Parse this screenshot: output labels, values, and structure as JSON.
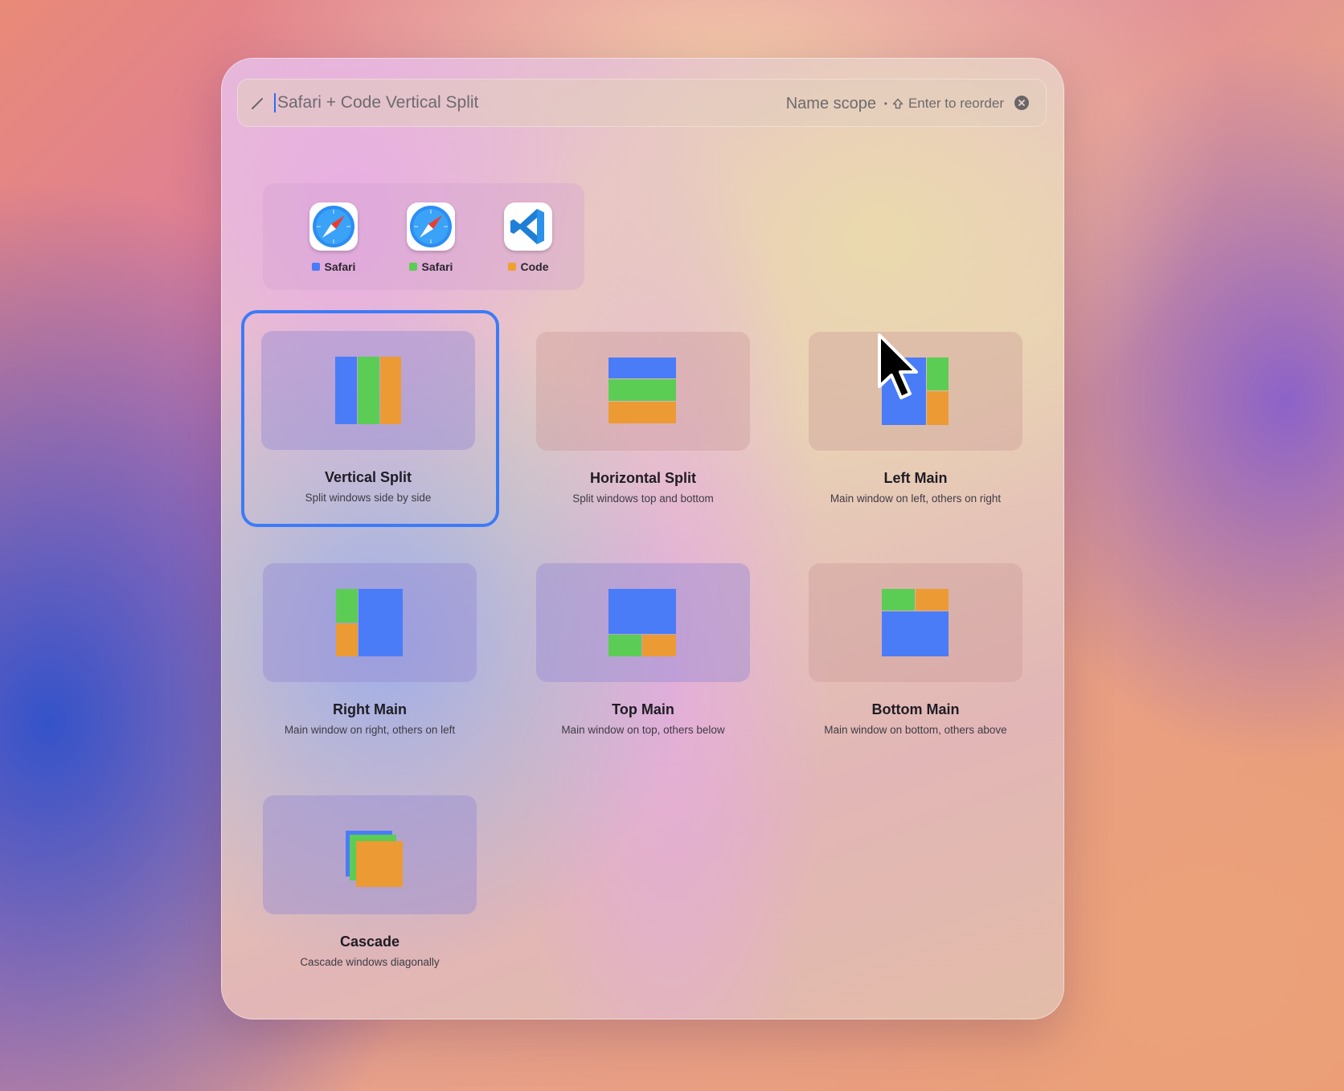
{
  "search": {
    "value": "Safari + Code Vertical Split",
    "scope_label": "Name scope",
    "hint": "Enter to reorder"
  },
  "apps": [
    {
      "name": "Safari",
      "icon": "safari-compass-icon",
      "color": "#4a7cf7"
    },
    {
      "name": "Safari",
      "icon": "safari-compass-icon",
      "color": "#5ccd54"
    },
    {
      "name": "Code",
      "icon": "vscode-icon",
      "color": "#f0a030"
    }
  ],
  "colors": {
    "blue": "#4a7cf7",
    "green": "#5ccd54",
    "orange": "#ec9a34",
    "accent": "#3d7bf6"
  },
  "layouts": [
    {
      "title": "Vertical Split",
      "desc": "Split windows side by side",
      "selected": true
    },
    {
      "title": "Horizontal Split",
      "desc": "Split windows top and bottom",
      "selected": false
    },
    {
      "title": "Left Main",
      "desc": "Main window on left, others on right",
      "selected": false
    },
    {
      "title": "Right Main",
      "desc": "Main window on right, others on left",
      "selected": false
    },
    {
      "title": "Top Main",
      "desc": "Main window on top, others below",
      "selected": false
    },
    {
      "title": "Bottom Main",
      "desc": "Main window on bottom, others above",
      "selected": false
    },
    {
      "title": "Cascade",
      "desc": "Cascade windows diagonally",
      "selected": false
    }
  ]
}
